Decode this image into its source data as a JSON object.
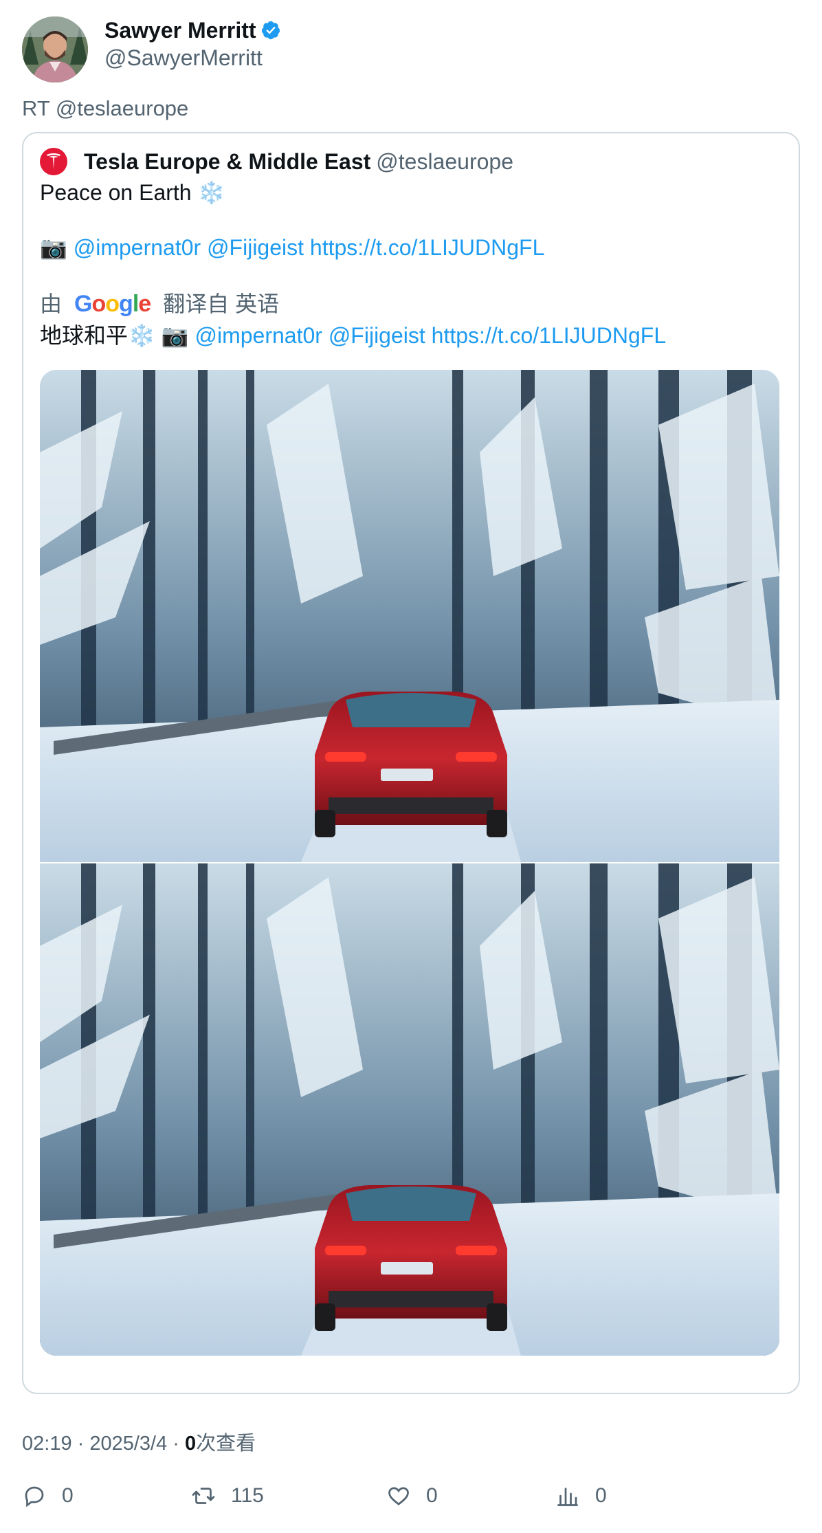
{
  "author": {
    "name": "Sawyer Merritt",
    "handle": "@SawyerMerritt"
  },
  "retweet_line": "RT @teslaeurope",
  "quoted": {
    "name": "Tesla Europe & Middle East",
    "handle": "@teslaeurope",
    "line1": "Peace on Earth",
    "line1_emoji": "❄️",
    "line2_emoji": "📷",
    "line2_links": [
      "@impernat0r",
      "@Fijigeist",
      "https://t.co/1LIJUDNgFL"
    ],
    "translate_by": "由",
    "translate_brand": "Google",
    "translate_suffix": "翻译自 英语",
    "translated_text": "地球和平",
    "translated_snow": "❄️",
    "translated_camera": "📷",
    "translated_links": [
      "@impernat0r",
      "@Fijigeist",
      "https://t.co/1LIJUDNgFL"
    ]
  },
  "meta": {
    "time_date": "02:19 · 2025/3/4 · ",
    "views_count": "0",
    "views_label": "次查看"
  },
  "actions": {
    "reply_count": "0",
    "retweet_count": "115",
    "like_count": "0",
    "views_count": "0"
  },
  "colors": {
    "link": "#1d9bf0",
    "muted": "#536471",
    "verified": "#1d9bf0",
    "tesla_red": "#e31937"
  }
}
